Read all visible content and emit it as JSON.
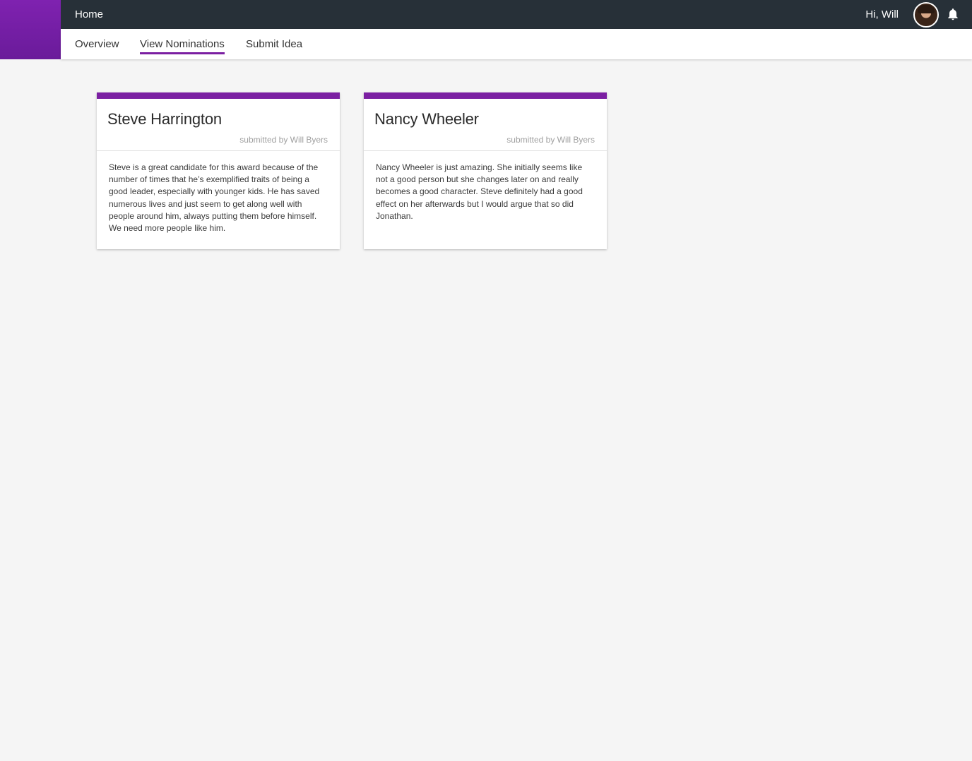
{
  "colors": {
    "accent": "#7b1fa2",
    "topbar": "#273038",
    "page_background": "#f5f5f5"
  },
  "topbar": {
    "home_label": "Home",
    "greeting": "Hi, Will",
    "avatar_icon": "user-avatar",
    "notification_icon": "bell-icon"
  },
  "subnav": {
    "tabs": [
      {
        "label": "Overview",
        "active": false
      },
      {
        "label": "View Nominations",
        "active": true
      },
      {
        "label": "Submit Idea",
        "active": false
      }
    ]
  },
  "nominations": [
    {
      "name": "Steve Harrington",
      "submitted_by": "submitted by Will Byers",
      "description": "Steve is a great candidate for this award because of the number of times that he’s exemplified traits of being a good leader, especially with younger kids. He has saved numerous lives and just seem to get along well with people around him, always putting them before himself. We need more people like him."
    },
    {
      "name": "Nancy Wheeler",
      "submitted_by": "submitted by Will Byers",
      "description": "Nancy Wheeler is just amazing. She initially seems like not a good person but she changes later on and really becomes a good character. Steve definitely had a good effect on her afterwards but I would argue that so did Jonathan."
    }
  ]
}
